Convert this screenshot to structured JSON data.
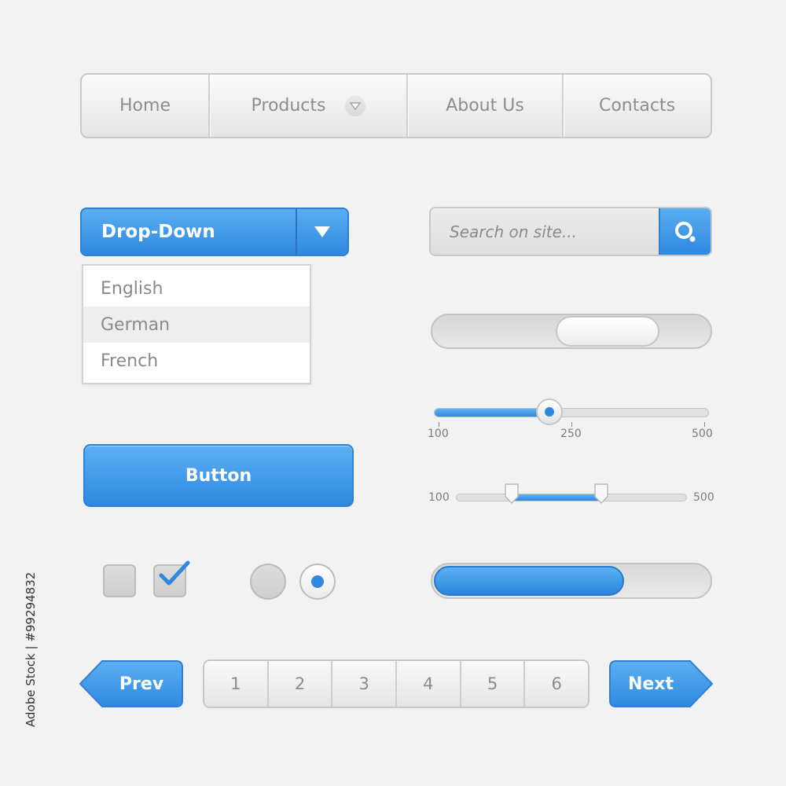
{
  "nav": {
    "items": [
      {
        "label": "Home"
      },
      {
        "label": "Products"
      },
      {
        "label": "About Us"
      },
      {
        "label": "Contacts"
      }
    ]
  },
  "dropdown": {
    "label": "Drop-Down",
    "options": [
      "English",
      "German",
      "French"
    ],
    "highlighted": "German"
  },
  "search": {
    "placeholder": "Search on site..."
  },
  "toggle": {
    "state": "center"
  },
  "slider": {
    "min_label": "100",
    "mid_label": "250",
    "max_label": "500",
    "value_fraction": 0.42
  },
  "range_slider": {
    "min_label": "100",
    "max_label": "500",
    "low_fraction": 0.24,
    "high_fraction": 0.63
  },
  "button": {
    "label": "Button"
  },
  "checkboxes": [
    {
      "checked": false
    },
    {
      "checked": true
    }
  ],
  "radios": [
    {
      "selected": false
    },
    {
      "selected": true
    }
  ],
  "progress": {
    "fraction": 0.69
  },
  "pagination": {
    "prev_label": "Prev",
    "next_label": "Next",
    "pages": [
      "1",
      "2",
      "3",
      "4",
      "5",
      "6"
    ]
  },
  "watermark_side": "Adobe Stock | #99294832",
  "colors": {
    "accent": "#2f88dd",
    "background": "#f2f2f2",
    "text": "#8a8a8a"
  }
}
